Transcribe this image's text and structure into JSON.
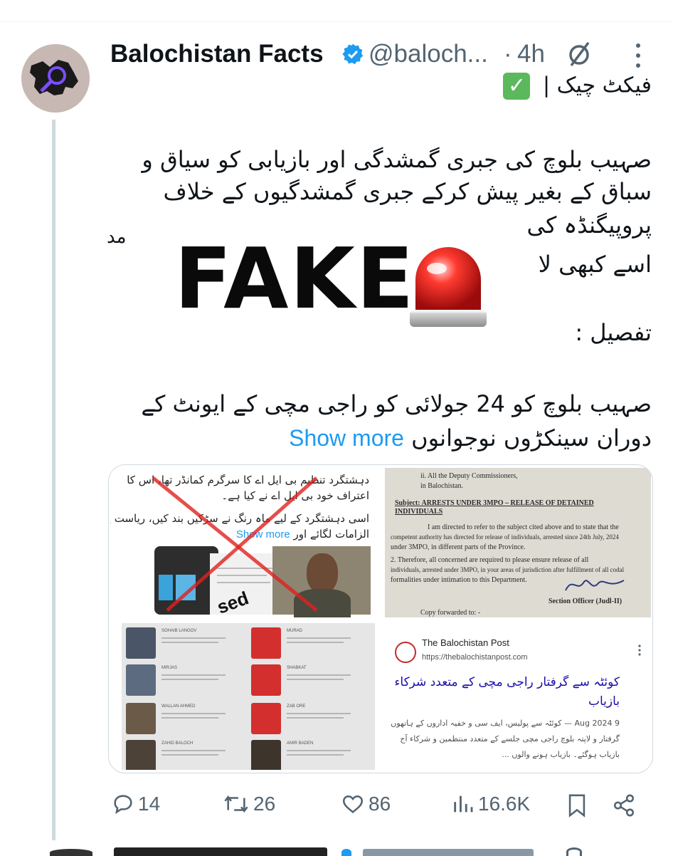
{
  "post": {
    "author_name": "Balochistan Facts",
    "handle": "@baloch...",
    "separator": "·",
    "time": "4h",
    "tag_text": "فیکٹ چیک |",
    "body_lines": [
      "صہیب بلوچ کی جبری گمشدگی اور بازیابی کو سیاق و",
      "سباق کے بغیر پیش کرکے جبری گمشدگیوں کے خلاف",
      "پروپیگنڈہ کی",
      "اسے کبھی لا",
      "تفصیل :",
      "صہیب بلوچ کو 24 جولائی کو راجی مچی کے ایونٹ کے",
      "دوران سینکڑوں نوجوانوں"
    ],
    "p3_suffix": "مد",
    "show_more": "Show more",
    "fake_overlay": "FAKE"
  },
  "media": {
    "img1": {
      "lines": [
        "دہشتگرد تنظیم بی ایل اے کا سرگرم کمانڈر تھا، اس کا",
        "اعتراف خود بی ایل اے نے کیا ہے۔",
        "اسی دہشتگرد کے لیے ماہ رنگ نے سڑکیں بند کیں، ریاست پر",
        "الزامات لگائے اور"
      ],
      "show_more": "Show more",
      "stamp": "sed"
    },
    "img2": {
      "lines": [
        "ii.      All the Deputy Commissioners,",
        "         in Balochistan.",
        "Subject:   ARRESTS UNDER 3MPO – RELEASE OF DETAINED",
        "           INDIVIDUALS",
        "I am directed to refer to the subject cited above and to state that the",
        "competent authority has directed for release of individuals, arrested since 24th July, 2024",
        "under 3MPO, in different parts of the Province.",
        "2.      Therefore, all concerned are required to please ensure release of all",
        "individuals, arrested under 3MPO, in your areas of jurisdiction after fulfillment of all codal",
        "formalities under intimation to this Department.",
        "Section Officer (Judl-II)",
        "Copy forwarded to: -"
      ]
    },
    "img3": {
      "names": [
        "SOHAIB LANGOV",
        "MURAD",
        "MIRJAS",
        "SHABKAT",
        "WALLAN AHMED",
        "ZAB ORE",
        "ZAHID BALOCH",
        "AMIR BADEN"
      ]
    },
    "img4": {
      "site": "The Balochistan Post",
      "url": "https://thebalochistanpost.com",
      "headline_1": "کوئٹہ سے گرفتار راجی مچی کے متعدد شرکاء",
      "headline_2": "بازیاب",
      "date_snippet": "9 Aug 2024 — کوئٹہ سے پولیس، ایف سی و خفیہ اداروں کے ہاتھوں",
      "body_2": "گرفتار و لاپتہ بلوچ راجی مچی جلسے کے متعدد منتظمین و شرکاء آج",
      "body_3": "بازیاب ہوگئے۔ بازیاب ہونے والوں ..."
    }
  },
  "actions": {
    "replies": "14",
    "reposts": "26",
    "likes": "86",
    "views": "16.6K"
  },
  "colors": {
    "link": "#1d9bf0",
    "muted": "#536471",
    "verified": "#1d9bf0",
    "check_green": "#5cb85c",
    "fake_red": "#e0211e"
  },
  "icons": [
    "verified-badge-icon",
    "grok-icon",
    "more-options-icon",
    "check-mark-icon",
    "siren-icon",
    "reply-icon",
    "repost-icon",
    "like-icon",
    "views-icon",
    "bookmark-icon",
    "share-icon"
  ]
}
